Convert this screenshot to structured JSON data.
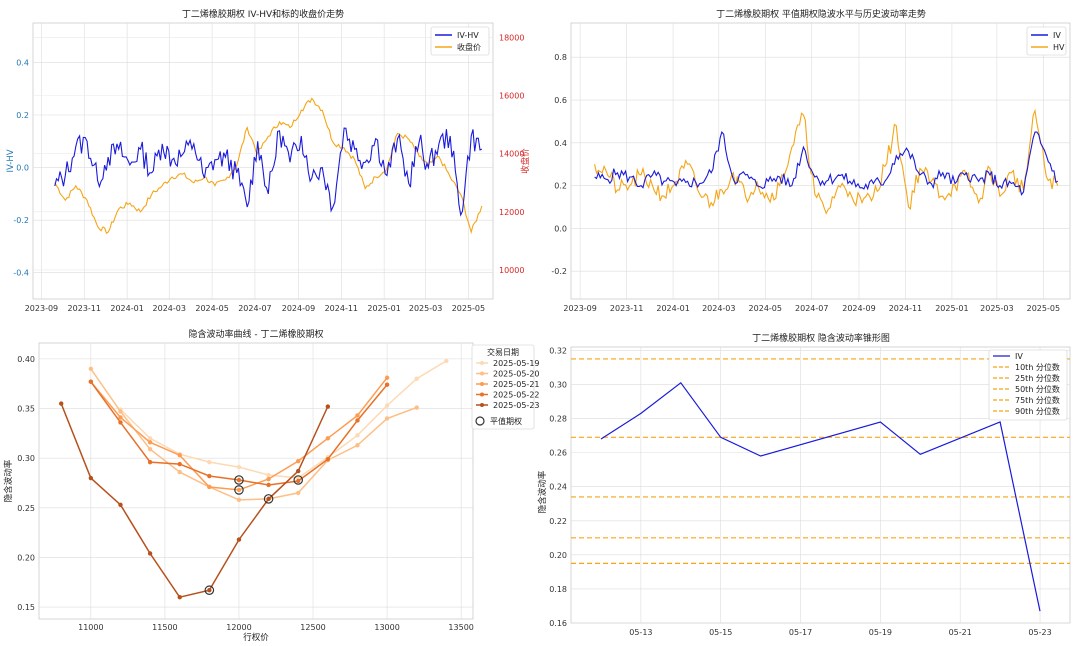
{
  "colors": {
    "iv": "#1a1adb",
    "hv": "#f5a516",
    "grid": "#dcdcdc",
    "tick_blue": "#1f77b4",
    "tick_red": "#d62728",
    "pctl": "#f5a516"
  },
  "charts": {
    "c1": {
      "title": "丁二烯橡胶期权 IV-HV和标的收盘价走势",
      "ylabel_left": "IV-HV",
      "ylabel_right": "收盘价",
      "x_ticks": [
        "2023-09",
        "2023-11",
        "2024-01",
        "2024-03",
        "2024-05",
        "2024-07",
        "2024-09",
        "2024-11",
        "2025-01",
        "2025-03",
        "2025-05"
      ],
      "y_left_ticks": [
        "-0.4",
        "-0.2",
        "0.0",
        "0.2",
        "0.4"
      ],
      "y_right_ticks": [
        "10000",
        "12000",
        "14000",
        "16000",
        "18000"
      ],
      "legend": [
        "IV-HV",
        "收盘价"
      ]
    },
    "c2": {
      "title": "丁二烯橡胶期权 平值期权隐波水平与历史波动率走势",
      "x_ticks": [
        "2023-09",
        "2023-11",
        "2024-01",
        "2024-03",
        "2024-05",
        "2024-07",
        "2024-09",
        "2024-11",
        "2025-01",
        "2025-03",
        "2025-05"
      ],
      "y_ticks": [
        "-0.2",
        "0.0",
        "0.2",
        "0.4",
        "0.6",
        "0.8"
      ],
      "legend": [
        "IV",
        "HV"
      ]
    },
    "c3": {
      "title": "隐含波动率曲线 - 丁二烯橡胶期权",
      "xlabel": "行权价",
      "ylabel": "隐含波动率",
      "x_ticks": [
        "11000",
        "11500",
        "12000",
        "12500",
        "13000",
        "13500"
      ],
      "y_ticks": [
        "0.15",
        "0.20",
        "0.25",
        "0.30",
        "0.35",
        "0.40"
      ],
      "legend_title": "交易日期",
      "legend": [
        "2025-05-19",
        "2025-05-20",
        "2025-05-21",
        "2025-05-22",
        "2025-05-23"
      ],
      "atm_label": "平值期权",
      "series_colors": [
        "#fdd9b4",
        "#fdbf86",
        "#fd9c51",
        "#e8712a",
        "#b6501c"
      ]
    },
    "c4": {
      "title": "丁二烯橡胶期权 隐含波动率锥形图",
      "ylabel": "隐含波动率",
      "x_ticks": [
        "05-13",
        "05-15",
        "05-17",
        "05-19",
        "05-21",
        "05-23"
      ],
      "y_ticks": [
        "0.16",
        "0.18",
        "0.20",
        "0.22",
        "0.24",
        "0.26",
        "0.28",
        "0.30",
        "0.32"
      ],
      "legend": [
        "IV",
        "10th 分位数",
        "25th 分位数",
        "50th 分位数",
        "75th 分位数",
        "90th 分位数"
      ]
    }
  },
  "chart_data": [
    {
      "type": "line",
      "title": "丁二烯橡胶期权 IV-HV和标的收盘价走势",
      "ylabel": "IV-HV",
      "y2label": "收盘价",
      "ylim": [
        -0.5,
        0.55
      ],
      "y2lim": [
        9000,
        18500
      ],
      "xlim": [
        "2023-08-20",
        "2025-06-05"
      ],
      "series": [
        {
          "name": "IV-HV",
          "axis": "left",
          "x": [
            "2023-09-20",
            "2023-10-05",
            "2023-10-20",
            "2023-11-05",
            "2023-11-20",
            "2023-12-05",
            "2023-12-20",
            "2024-01-05",
            "2024-01-20",
            "2024-02-05",
            "2024-02-20",
            "2024-03-05",
            "2024-03-20",
            "2024-04-05",
            "2024-04-20",
            "2024-05-05",
            "2024-05-20",
            "2024-06-05",
            "2024-06-20",
            "2024-07-05",
            "2024-07-20",
            "2024-08-05",
            "2024-08-20",
            "2024-09-05",
            "2024-09-20",
            "2024-10-05",
            "2024-10-20",
            "2024-11-05",
            "2024-11-20",
            "2024-12-05",
            "2024-12-20",
            "2025-01-05",
            "2025-01-20",
            "2025-02-05",
            "2025-02-20",
            "2025-03-05",
            "2025-03-20",
            "2025-04-05",
            "2025-04-20",
            "2025-05-05",
            "2025-05-20"
          ],
          "values": [
            -0.07,
            -0.03,
            0.08,
            0.1,
            -0.05,
            0.04,
            0.07,
            0.01,
            0.07,
            -0.02,
            0.09,
            0.03,
            0.05,
            0.09,
            -0.04,
            0.03,
            0.04,
            -0.02,
            -0.15,
            0.1,
            -0.1,
            0.14,
            0.02,
            0.12,
            -0.04,
            0.0,
            -0.15,
            0.15,
            0.07,
            0.02,
            0.11,
            -0.03,
            0.11,
            -0.06,
            0.1,
            0.0,
            0.09,
            0.12,
            -0.18,
            0.12,
            0.07
          ]
        },
        {
          "name": "收盘价",
          "axis": "right",
          "x": [
            "2023-09-20",
            "2023-10-05",
            "2023-10-20",
            "2023-11-05",
            "2023-11-20",
            "2023-12-05",
            "2023-12-20",
            "2024-01-05",
            "2024-01-20",
            "2024-02-05",
            "2024-02-20",
            "2024-03-05",
            "2024-03-20",
            "2024-04-05",
            "2024-04-20",
            "2024-05-05",
            "2024-05-20",
            "2024-06-05",
            "2024-06-20",
            "2024-07-05",
            "2024-07-20",
            "2024-08-05",
            "2024-08-20",
            "2024-09-05",
            "2024-09-20",
            "2024-10-05",
            "2024-10-20",
            "2024-11-05",
            "2024-11-20",
            "2024-12-05",
            "2024-12-20",
            "2025-01-05",
            "2025-01-20",
            "2025-02-05",
            "2025-02-20",
            "2025-03-05",
            "2025-03-20",
            "2025-04-05",
            "2025-04-20",
            "2025-05-05",
            "2025-05-20"
          ],
          "values": [
            13000,
            12400,
            12900,
            12400,
            11500,
            11300,
            12100,
            12300,
            12000,
            12600,
            12900,
            13200,
            13300,
            13000,
            13200,
            12900,
            13100,
            13600,
            14900,
            14000,
            14600,
            15100,
            14900,
            15500,
            15900,
            15500,
            14400,
            14200,
            13800,
            12800,
            13200,
            13500,
            14700,
            14500,
            13900,
            13600,
            13900,
            13200,
            12600,
            11300,
            12200
          ]
        }
      ]
    },
    {
      "type": "line",
      "title": "丁二烯橡胶期权 平值期权隐波水平与历史波动率走势",
      "ylim": [
        -0.33,
        0.96
      ],
      "xlim": [
        "2023-08-20",
        "2025-06-05"
      ],
      "series": [
        {
          "name": "IV",
          "x": [
            "2023-09-20",
            "2023-10-05",
            "2023-10-20",
            "2023-11-05",
            "2023-11-20",
            "2023-12-05",
            "2023-12-20",
            "2024-01-05",
            "2024-01-20",
            "2024-02-05",
            "2024-02-20",
            "2024-03-05",
            "2024-03-20",
            "2024-04-05",
            "2024-04-20",
            "2024-05-05",
            "2024-05-20",
            "2024-06-05",
            "2024-06-20",
            "2024-07-05",
            "2024-07-20",
            "2024-08-05",
            "2024-08-20",
            "2024-09-05",
            "2024-09-20",
            "2024-10-05",
            "2024-10-20",
            "2024-11-05",
            "2024-11-20",
            "2024-12-05",
            "2024-12-20",
            "2025-01-05",
            "2025-01-20",
            "2025-02-05",
            "2025-02-20",
            "2025-03-05",
            "2025-03-20",
            "2025-04-05",
            "2025-04-20",
            "2025-05-05",
            "2025-05-20"
          ],
          "values": [
            0.24,
            0.23,
            0.26,
            0.24,
            0.2,
            0.25,
            0.22,
            0.2,
            0.22,
            0.21,
            0.26,
            0.45,
            0.23,
            0.25,
            0.2,
            0.22,
            0.24,
            0.2,
            0.38,
            0.24,
            0.22,
            0.25,
            0.22,
            0.19,
            0.21,
            0.22,
            0.34,
            0.36,
            0.25,
            0.21,
            0.26,
            0.21,
            0.26,
            0.22,
            0.25,
            0.2,
            0.21,
            0.17,
            0.45,
            0.34,
            0.22
          ]
        },
        {
          "name": "HV",
          "x": [
            "2023-09-20",
            "2023-10-05",
            "2023-10-20",
            "2023-11-05",
            "2023-11-20",
            "2023-12-05",
            "2023-12-20",
            "2024-01-05",
            "2024-01-20",
            "2024-02-05",
            "2024-02-20",
            "2024-03-05",
            "2024-03-20",
            "2024-04-05",
            "2024-04-20",
            "2024-05-05",
            "2024-05-20",
            "2024-06-05",
            "2024-06-20",
            "2024-07-05",
            "2024-07-20",
            "2024-08-05",
            "2024-08-20",
            "2024-09-05",
            "2024-09-20",
            "2024-10-05",
            "2024-10-20",
            "2024-11-05",
            "2024-11-20",
            "2024-12-05",
            "2024-12-20",
            "2025-01-05",
            "2025-01-20",
            "2025-02-05",
            "2025-02-20",
            "2025-03-05",
            "2025-03-20",
            "2025-04-05",
            "2025-04-20",
            "2025-05-05",
            "2025-05-20"
          ],
          "values": [
            0.3,
            0.27,
            0.18,
            0.2,
            0.25,
            0.2,
            0.15,
            0.22,
            0.3,
            0.16,
            0.12,
            0.18,
            0.26,
            0.15,
            0.22,
            0.14,
            0.2,
            0.38,
            0.53,
            0.16,
            0.07,
            0.2,
            0.17,
            0.12,
            0.15,
            0.29,
            0.48,
            0.1,
            0.28,
            0.22,
            0.15,
            0.2,
            0.25,
            0.12,
            0.28,
            0.15,
            0.26,
            0.18,
            0.55,
            0.24,
            0.2
          ]
        }
      ]
    },
    {
      "type": "line",
      "title": "隐含波动率曲线 - 丁二烯橡胶期权",
      "xlabel": "行权价",
      "ylabel": "隐含波动率",
      "xlim": [
        10650,
        13580
      ],
      "ylim": [
        0.138,
        0.416
      ],
      "series": [
        {
          "name": "2025-05-19",
          "x": [
            11200,
            11400,
            11600,
            11800,
            12000,
            12200,
            12400,
            12600,
            12800,
            13000,
            13200,
            13400
          ],
          "values": [
            0.349,
            0.32,
            0.304,
            0.296,
            0.291,
            0.283,
            0.28,
            0.301,
            0.323,
            0.353,
            0.38,
            0.398
          ]
        },
        {
          "name": "2025-05-20",
          "x": [
            11000,
            11200,
            11400,
            11600,
            11800,
            12000,
            12200,
            12400,
            12600,
            12800,
            13000,
            13200
          ],
          "values": [
            0.39,
            0.347,
            0.309,
            0.286,
            0.271,
            0.258,
            0.259,
            0.265,
            0.298,
            0.313,
            0.34,
            0.351
          ]
        },
        {
          "name": "2025-05-21",
          "x": [
            11000,
            11200,
            11400,
            11600,
            11800,
            12000,
            12200,
            12400,
            12600,
            12800,
            13000
          ],
          "values": [
            0.377,
            0.341,
            0.316,
            0.303,
            0.271,
            0.268,
            0.279,
            0.297,
            0.32,
            0.343,
            0.381
          ]
        },
        {
          "name": "2025-05-22",
          "x": [
            11000,
            11200,
            11400,
            11600,
            11800,
            12000,
            12200,
            12400,
            12600,
            12800,
            13000
          ],
          "values": [
            0.377,
            0.336,
            0.296,
            0.294,
            0.282,
            0.278,
            0.273,
            0.277,
            0.299,
            0.338,
            0.374
          ]
        },
        {
          "name": "2025-05-23",
          "x": [
            10800,
            11000,
            11200,
            11400,
            11600,
            11800,
            12000,
            12200,
            12400,
            12600
          ],
          "values": [
            0.355,
            0.28,
            0.253,
            0.204,
            0.16,
            0.167,
            0.218,
            0.259,
            0.287,
            0.352
          ]
        }
      ],
      "atm_points": [
        {
          "x": 11800,
          "y": 0.167
        },
        {
          "x": 12000,
          "y": 0.268
        },
        {
          "x": 12000,
          "y": 0.278
        },
        {
          "x": 12200,
          "y": 0.259
        },
        {
          "x": 12400,
          "y": 0.278
        }
      ]
    },
    {
      "type": "line",
      "title": "丁二烯橡胶期权 隐含波动率锥形图",
      "ylabel": "隐含波动率",
      "xlim": [
        "05-11 12:00",
        "05-23 12:00"
      ],
      "ylim": [
        0.16,
        0.322
      ],
      "series": [
        {
          "name": "IV",
          "x": [
            "05-12",
            "05-13",
            "05-14",
            "05-15",
            "05-16",
            "05-19",
            "05-20",
            "05-22",
            "05-23"
          ],
          "values": [
            0.268,
            0.283,
            0.301,
            0.269,
            0.258,
            0.278,
            0.259,
            0.278,
            0.167
          ]
        }
      ],
      "percentiles": [
        {
          "name": "10th 分位数",
          "value": 0.195
        },
        {
          "name": "25th 分位数",
          "value": 0.21
        },
        {
          "name": "50th 分位数",
          "value": 0.234
        },
        {
          "name": "75th 分位数",
          "value": 0.269
        },
        {
          "name": "90th 分位数",
          "value": 0.315
        }
      ]
    }
  ]
}
